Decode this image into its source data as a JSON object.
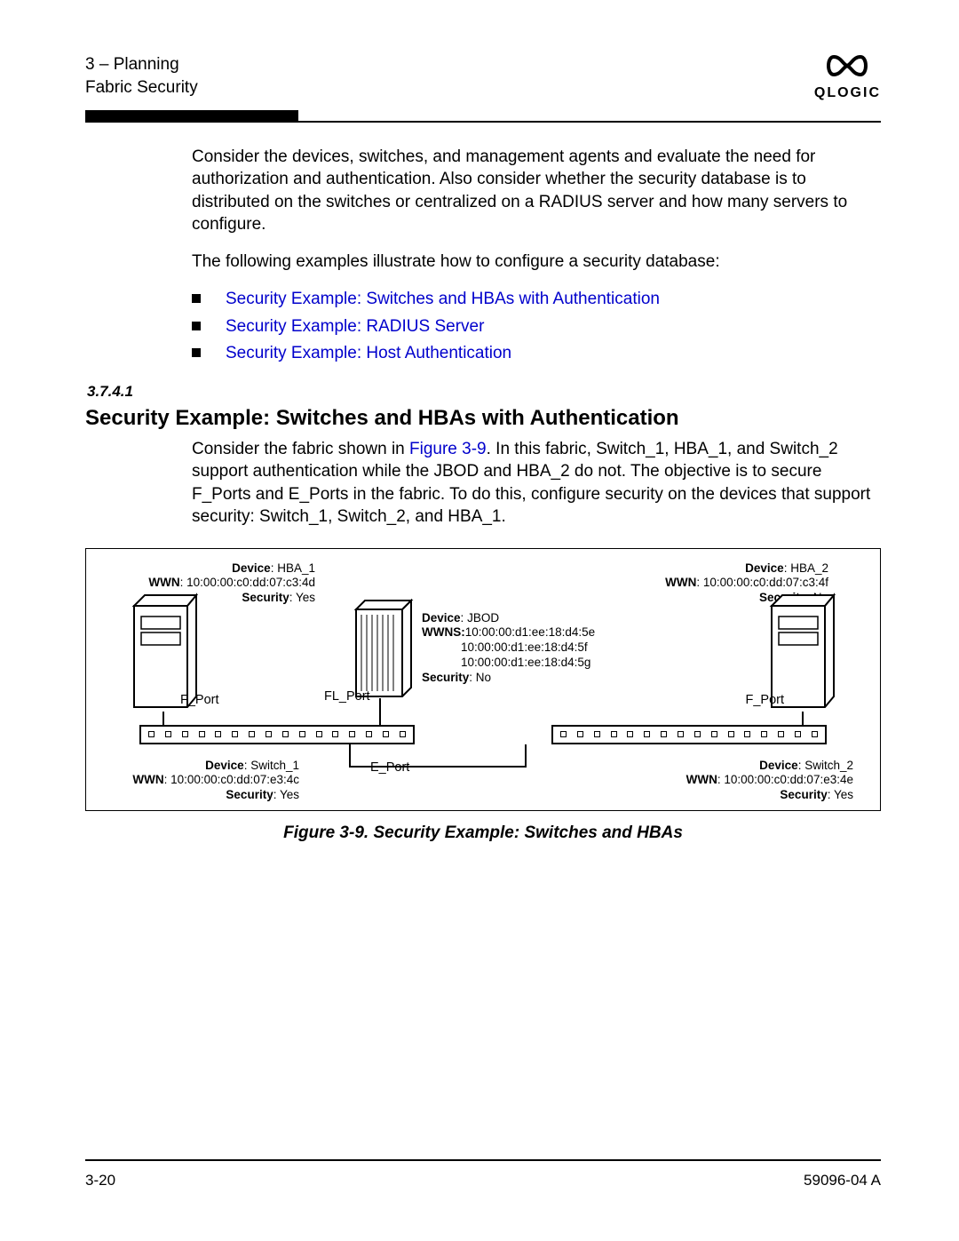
{
  "header": {
    "chapter": "3 – Planning",
    "section": "Fabric Security",
    "logo_text": "QLOGIC"
  },
  "intro": {
    "p1": "Consider the devices, switches, and management agents and evaluate the need for authorization and authentication. Also consider whether the security database is to distributed on the switches or centralized on a RADIUS server and how many servers to configure.",
    "p2": "The following examples illustrate how to configure a security database:"
  },
  "bullets": [
    "Security Example: Switches and HBAs with Authentication",
    "Security Example: RADIUS Server",
    "Security Example: Host Authentication"
  ],
  "section_heading": {
    "number": "3.7.4.1",
    "title": "Security Example: Switches and HBAs with Authentication",
    "para_a": "Consider the fabric shown in ",
    "fig_ref": "Figure 3-9",
    "para_b": ". In this fabric, Switch_1, HBA_1, and Switch_2 support authentication while the JBOD and HBA_2 do not. The objective is to secure F_Ports and E_Ports in the fabric. To do this, configure security on the devices that support security: Switch_1, Switch_2, and HBA_1."
  },
  "figure": {
    "caption": "Figure 3-9.  Security Example: Switches and HBAs",
    "hba1": {
      "device": "HBA_1",
      "wwn": "10:00:00:c0:dd:07:c3:4d",
      "security": "Yes"
    },
    "hba2": {
      "device": "HBA_2",
      "wwn": "10:00:00:c0:dd:07:c3:4f",
      "security": "No"
    },
    "jbod": {
      "device": "JBOD",
      "wwns1": "10:00:00:d1:ee:18:d4:5e",
      "wwns2": "10:00:00:d1:ee:18:d4:5f",
      "wwns3": "10:00:00:d1:ee:18:d4:5g",
      "security": "No"
    },
    "sw1": {
      "device": "Switch_1",
      "wwn": "10:00:00:c0:dd:07:e3:4c",
      "security": "Yes"
    },
    "sw2": {
      "device": "Switch_2",
      "wwn": "10:00:00:c0:dd:07:e3:4e",
      "security": "Yes"
    },
    "ports": {
      "f1": "F_Port",
      "fl": "FL_Port",
      "f2": "F_Port",
      "e": "E_Port"
    }
  },
  "footer": {
    "page": "3-20",
    "docid": "59096-04  A"
  }
}
